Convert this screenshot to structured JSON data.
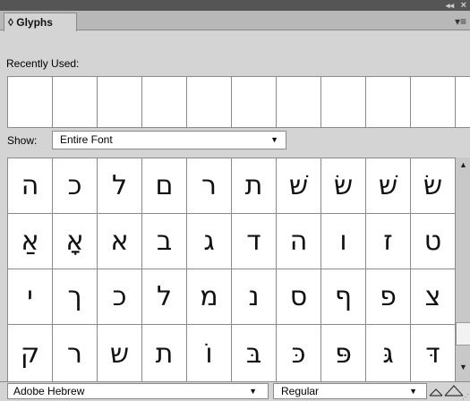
{
  "window": {
    "collapse_glyph": "◂◂",
    "close_glyph": "×"
  },
  "panel": {
    "tab_label": "◊ Glyphs",
    "menu_icon": "▾≡"
  },
  "recent": {
    "label": "Recently Used:",
    "cell_count": 10
  },
  "show": {
    "label": "Show:",
    "value": "Entire Font"
  },
  "glyph_rows": [
    [
      "ה",
      "כ",
      "ל",
      "ם",
      "ר",
      "ת",
      "שׁ",
      "שׂ",
      "שׁ",
      "שׂ"
    ],
    [
      "אַ",
      "אָ",
      "א",
      "ב",
      "ג",
      "ד",
      "ה",
      "ו",
      "ז",
      "ט"
    ],
    [
      "י",
      "ך",
      "כ",
      "ל",
      "מ",
      "נ",
      "ס",
      "ף",
      "פ",
      "צ"
    ],
    [
      "ק",
      "ר",
      "ש",
      "ת",
      "וֹ",
      "בּ",
      "כּ",
      "פּ",
      "גּ",
      "דּ"
    ]
  ],
  "bottom": {
    "font_family": "Adobe Hebrew",
    "font_style": "Regular"
  },
  "colors": {
    "titlebar": "#555555",
    "panel_bg": "#d4d4d4",
    "grid_bg": "#ffffff",
    "border": "#8a8a8a"
  }
}
